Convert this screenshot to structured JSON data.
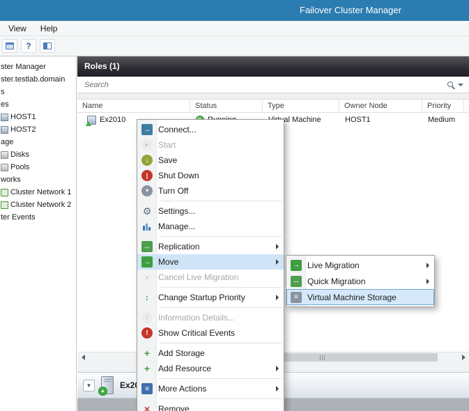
{
  "colors": {
    "titlebar_blue": "#2b7cb0",
    "roles_header_dark": "#2e2f34",
    "menu_highlight_blue": "#cfe4f7",
    "status_running_green": "#3f9e3f",
    "disabled_text_gray": "#a8a8a8"
  },
  "window": {
    "title": "Failover Cluster Manager"
  },
  "menubar": {
    "items": [
      {
        "label": "View"
      },
      {
        "label": "Help"
      }
    ]
  },
  "toolbar": {
    "icons": [
      "console-window-icon",
      "help-icon",
      "show-hide-tree-icon"
    ]
  },
  "sidebar": {
    "items": [
      {
        "label": "ster Manager"
      },
      {
        "label": "ster.testlab.domain"
      },
      {
        "label": "s"
      },
      {
        "label": "es"
      },
      {
        "label": "HOST1",
        "icon": "server-icon"
      },
      {
        "label": "HOST2",
        "icon": "server-icon"
      },
      {
        "label": "age"
      },
      {
        "label": "Disks",
        "icon": "disk-icon"
      },
      {
        "label": "Pools",
        "icon": "disk-icon"
      },
      {
        "label": "works"
      },
      {
        "label": "Cluster Network 1",
        "icon": "network-icon"
      },
      {
        "label": "Cluster Network 2",
        "icon": "network-icon"
      },
      {
        "label": "ter Events"
      }
    ]
  },
  "roles": {
    "header": "Roles (1)",
    "search_placeholder": "Search",
    "columns": [
      {
        "label": "Name"
      },
      {
        "label": "Status"
      },
      {
        "label": "Type"
      },
      {
        "label": "Owner Node"
      },
      {
        "label": "Priority"
      }
    ],
    "rows": [
      {
        "name": "Ex2010",
        "status": "Running",
        "type": "Virtual Machine",
        "owner_node": "HOST1",
        "priority": "Medium"
      }
    ]
  },
  "context_menu": {
    "items": [
      {
        "label": "Connect...",
        "icon": "connect-icon",
        "enabled": true
      },
      {
        "label": "Start",
        "icon": "start-icon",
        "enabled": false
      },
      {
        "label": "Save",
        "icon": "save-icon",
        "enabled": true
      },
      {
        "label": "Shut Down",
        "icon": "shutdown-icon",
        "enabled": true
      },
      {
        "label": "Turn Off",
        "icon": "turn-off-icon",
        "enabled": true
      },
      {
        "label": "Settings...",
        "icon": "settings-icon",
        "enabled": true
      },
      {
        "label": "Manage...",
        "icon": "manage-icon",
        "enabled": true
      },
      {
        "label": "Replication",
        "icon": "replication-icon",
        "enabled": true,
        "has_submenu": true
      },
      {
        "label": "Move",
        "icon": "move-icon",
        "enabled": true,
        "has_submenu": true,
        "highlighted": true
      },
      {
        "label": "Cancel Live Migration",
        "icon": "cancel-live-migration-icon",
        "enabled": false
      },
      {
        "label": "Change Startup Priority",
        "icon": "change-priority-icon",
        "enabled": true,
        "has_submenu": true
      },
      {
        "label": "Information Details...",
        "icon": "information-icon",
        "enabled": false
      },
      {
        "label": "Show Critical Events",
        "icon": "critical-events-icon",
        "enabled": true
      },
      {
        "label": "Add Storage",
        "icon": "add-storage-icon",
        "enabled": true
      },
      {
        "label": "Add Resource",
        "icon": "add-resource-icon",
        "enabled": true,
        "has_submenu": true
      },
      {
        "label": "More Actions",
        "icon": "more-actions-icon",
        "enabled": true,
        "has_submenu": true
      },
      {
        "label": "Remove",
        "icon": "remove-icon",
        "enabled": true
      }
    ]
  },
  "move_submenu": {
    "items": [
      {
        "label": "Live Migration",
        "icon": "live-migration-icon",
        "has_submenu": true
      },
      {
        "label": "Quick Migration",
        "icon": "quick-migration-icon",
        "has_submenu": true
      },
      {
        "label": "Virtual Machine Storage",
        "icon": "vm-storage-icon",
        "selected": true
      }
    ]
  },
  "detail_panel": {
    "title": "Ex2010"
  }
}
